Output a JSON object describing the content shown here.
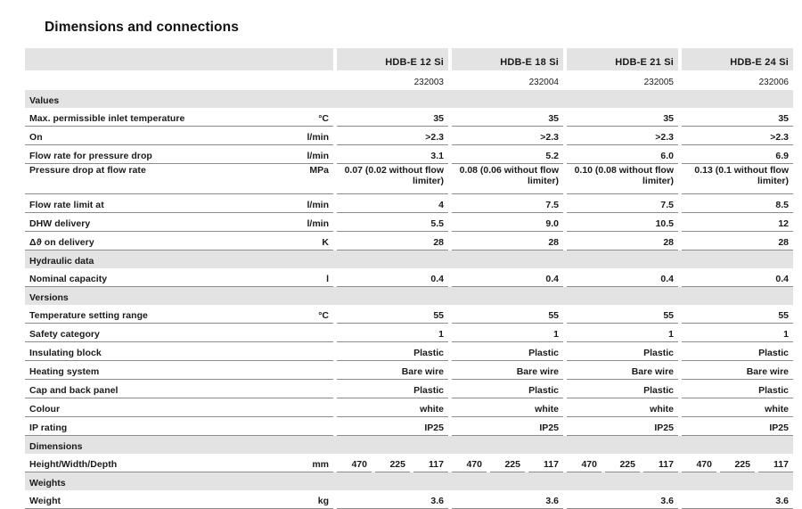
{
  "title": "Dimensions and connections",
  "columns": {
    "label_header": "",
    "unit_header": "",
    "products": [
      {
        "name": "HDB-E 12 Si",
        "code": "232003"
      },
      {
        "name": "HDB-E 18 Si",
        "code": "232004"
      },
      {
        "name": "HDB-E 21 Si",
        "code": "232005"
      },
      {
        "name": "HDB-E 24 Si",
        "code": "232006"
      }
    ]
  },
  "sections": [
    {
      "title": "Values",
      "rows": [
        {
          "label": "Max. permissible inlet temperature",
          "unit": "°C",
          "values": [
            "35",
            "35",
            "35",
            "35"
          ]
        },
        {
          "label": "On",
          "unit": "l/min",
          "values": [
            ">2.3",
            ">2.3",
            ">2.3",
            ">2.3"
          ]
        },
        {
          "label": "Flow rate for pressure drop",
          "unit": "l/min",
          "values": [
            "3.1",
            "5.2",
            "6.0",
            "6.9"
          ]
        },
        {
          "label": "Pressure drop at flow rate",
          "unit": "MPa",
          "values": [
            "0.07 (0.02 without flow limiter)",
            "0.08 (0.06 without flow limiter)",
            "0.10 (0.08 without flow limiter)",
            "0.13 (0.1 without flow limiter)"
          ]
        },
        {
          "label": "Flow rate limit at",
          "unit": "l/min",
          "values": [
            "4",
            "7.5",
            "7.5",
            "8.5"
          ]
        },
        {
          "label": "DHW delivery",
          "unit": "l/min",
          "values": [
            "5.5",
            "9.0",
            "10.5",
            "12"
          ]
        },
        {
          "label": "Δϑ on delivery",
          "unit": "K",
          "values": [
            "28",
            "28",
            "28",
            "28"
          ]
        }
      ]
    },
    {
      "title": "Hydraulic data",
      "rows": [
        {
          "label": "Nominal capacity",
          "unit": "l",
          "values": [
            "0.4",
            "0.4",
            "0.4",
            "0.4"
          ]
        }
      ]
    },
    {
      "title": "Versions",
      "rows": [
        {
          "label": "Temperature setting range",
          "unit": "°C",
          "values": [
            "55",
            "55",
            "55",
            "55"
          ]
        },
        {
          "label": "Safety category",
          "unit": "",
          "values": [
            "1",
            "1",
            "1",
            "1"
          ]
        },
        {
          "label": "Insulating block",
          "unit": "",
          "values": [
            "Plastic",
            "Plastic",
            "Plastic",
            "Plastic"
          ]
        },
        {
          "label": "Heating system",
          "unit": "",
          "values": [
            "Bare wire",
            "Bare wire",
            "Bare wire",
            "Bare wire"
          ]
        },
        {
          "label": "Cap and back panel",
          "unit": "",
          "values": [
            "Plastic",
            "Plastic",
            "Plastic",
            "Plastic"
          ]
        },
        {
          "label": "Colour",
          "unit": "",
          "values": [
            "white",
            "white",
            "white",
            "white"
          ]
        },
        {
          "label": "IP rating",
          "unit": "",
          "values": [
            "IP25",
            "IP25",
            "IP25",
            "IP25"
          ]
        }
      ]
    },
    {
      "title": "Dimensions",
      "rows": [
        {
          "label": "Height/Width/Depth",
          "unit": "mm",
          "triple": true,
          "values": [
            [
              "470",
              "225",
              "117"
            ],
            [
              "470",
              "225",
              "117"
            ],
            [
              "470",
              "225",
              "117"
            ],
            [
              "470",
              "225",
              "117"
            ]
          ]
        }
      ]
    },
    {
      "title": "Weights",
      "rows": [
        {
          "label": "Weight",
          "unit": "kg",
          "values": [
            "3.6",
            "3.6",
            "3.6",
            "3.6"
          ]
        }
      ]
    }
  ],
  "colors": {
    "band_gray": "#e3e3e3",
    "rule_gray": "#8c8c8c",
    "text": "#1a1a1a",
    "background": "#ffffff"
  }
}
